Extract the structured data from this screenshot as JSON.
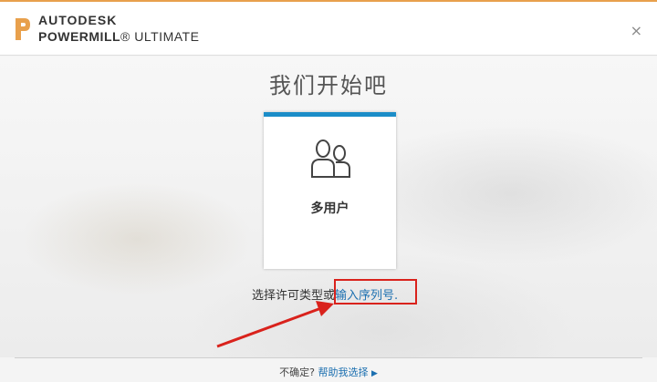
{
  "header": {
    "brand_company": "AUTODESK",
    "brand_product_bold": "POWERMILL",
    "brand_product_edition": "ULTIMATE",
    "close_label": "×"
  },
  "main": {
    "title": "我们开始吧",
    "card": {
      "label": "多用户",
      "icon": "users-icon"
    },
    "license_prompt": "选择许可类型或",
    "serial_link": "输入序列号."
  },
  "footer": {
    "question": "不确定?",
    "help_link": "帮助我选择",
    "help_arrow": "▶"
  },
  "colors": {
    "accent": "#1b8dc8",
    "link": "#1b6fb0",
    "annotation": "#d9221c",
    "logo": "#e8a04c"
  }
}
